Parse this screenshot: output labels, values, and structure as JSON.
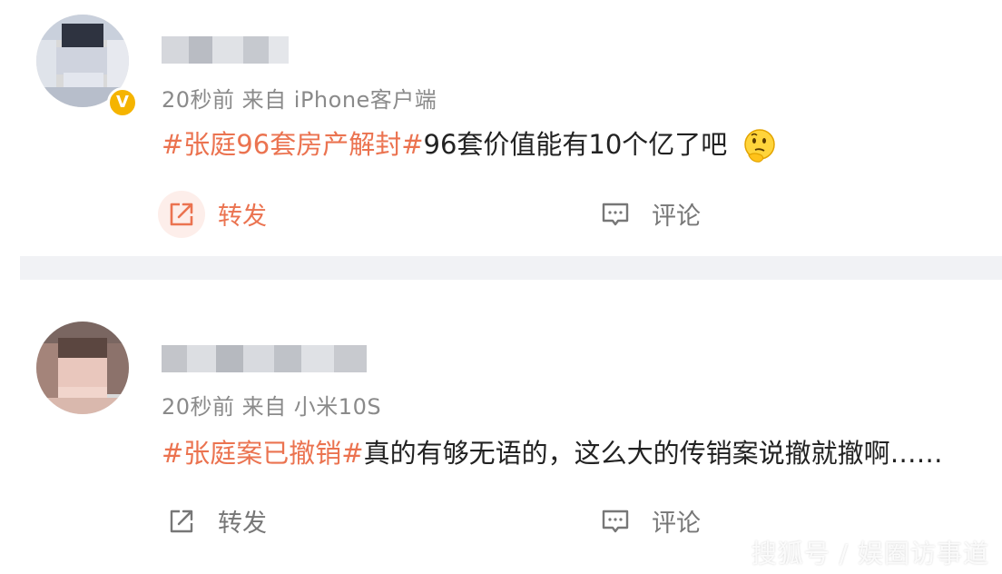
{
  "posts": [
    {
      "meta": "20秒前  来自 iPhone客户端",
      "tag": "#张庭96套房产解封#",
      "text": "96套价值能有10个亿了吧",
      "repost_label": "转发",
      "comment_label": "评论",
      "verified_badge": "V"
    },
    {
      "meta": "20秒前  来自 小米10S",
      "tag": "#张庭案已撤销#",
      "text": "真的有够无语的，这么大的传销案说撤就撤啊……",
      "repost_label": "转发",
      "comment_label": "评论"
    }
  ],
  "colors": {
    "tag": "#eb7350",
    "meta": "#8a8a8a",
    "divider": "#f1f2f5",
    "badge": "#f5b400"
  },
  "icons": [
    "repost-icon",
    "comment-icon",
    "thinking-face-emoji",
    "verified-badge-icon"
  ],
  "watermark": "搜狐号 / 娱圈访事道"
}
